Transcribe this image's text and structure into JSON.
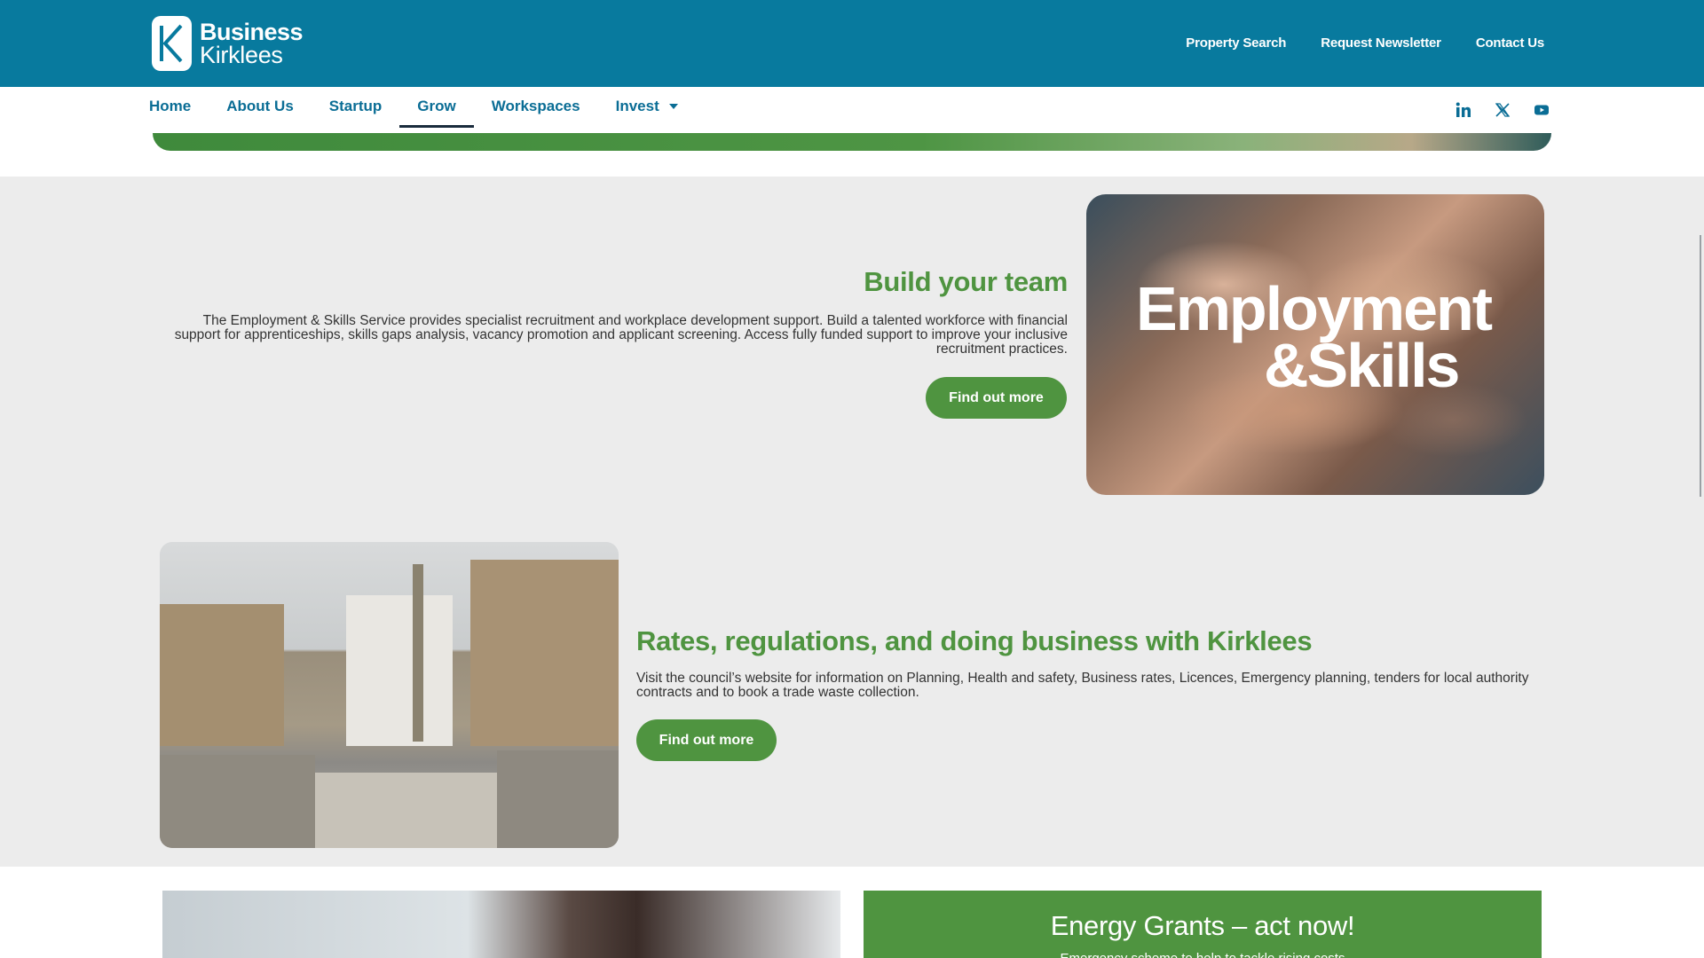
{
  "header": {
    "logo": {
      "line1": "Business",
      "line2": "Kirklees",
      "letter": "K"
    },
    "utility_links": [
      "Property Search",
      "Request Newsletter",
      "Contact Us"
    ],
    "bg_color": "#087a9e"
  },
  "nav": {
    "items": [
      {
        "label": "Home",
        "active": false
      },
      {
        "label": "About Us",
        "active": false
      },
      {
        "label": "Startup",
        "active": false
      },
      {
        "label": "Grow",
        "active": true
      },
      {
        "label": "Workspaces",
        "active": false
      },
      {
        "label": "Invest",
        "active": false,
        "dropdown": true
      }
    ],
    "socials": [
      "linkedin-icon",
      "x-icon",
      "youtube-icon"
    ]
  },
  "section_team": {
    "heading": "Build your team",
    "body": "The Employment & Skills Service provides specialist recruitment and workplace development support. Build a talented workforce with financial support for apprenticeships, skills gaps analysis, vacancy promotion and applicant screening. Access fully funded support to improve your inclusive recruitment practices.",
    "button": "Find out more",
    "image_text": {
      "line1": "Employment",
      "line2": "&Skills"
    }
  },
  "section_rates": {
    "heading": "Rates, regulations, and doing business with Kirklees",
    "body": "Visit the council’s website for information on Planning, Health and safety, Business rates, Licences, Emergency planning, tenders for local authority contracts and to book a trade waste collection.",
    "button": "Find out more"
  },
  "energy_card": {
    "title": "Energy Grants – act now!",
    "subtitle": "Emergency scheme to help to tackle rising costs"
  },
  "colors": {
    "brand_blue": "#087a9e",
    "accent_green": "#4f9440",
    "nav_text": "#0a6d95"
  }
}
